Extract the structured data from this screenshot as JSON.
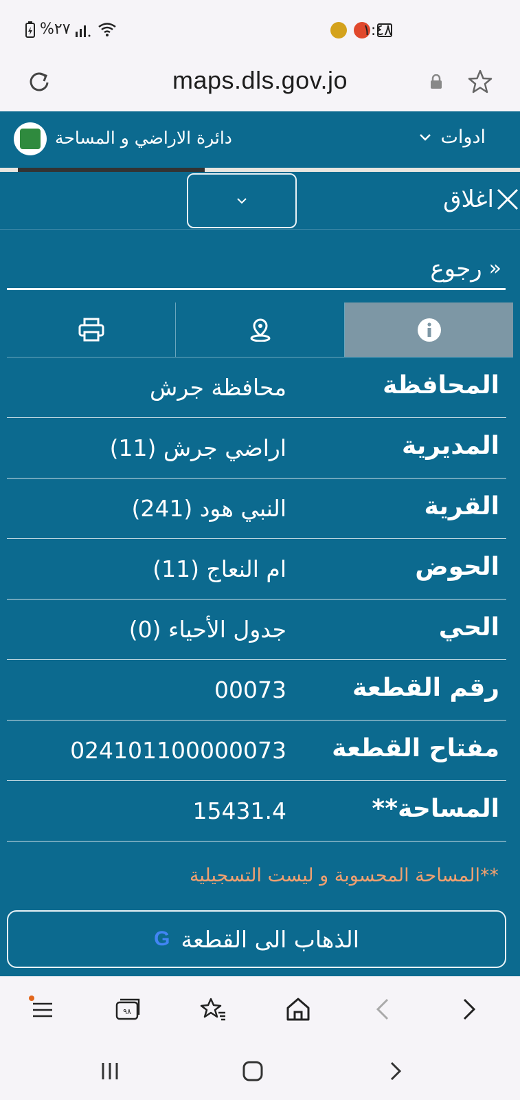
{
  "status_bar": {
    "time": "١:٤٨",
    "battery": "%٢٧",
    "signal_icon": "signal-icon",
    "wifi_icon": "wifi-icon"
  },
  "browser": {
    "url": "maps.dls.gov.jo"
  },
  "app_header": {
    "title": "دائرة الاراضي و المساحة",
    "tools_label": "ادوات"
  },
  "panel": {
    "close_label": "اغلاق",
    "back_label": "رجوع",
    "back_chevron": "«",
    "tabs": [
      {
        "name": "info",
        "icon": "info-icon",
        "active": true
      },
      {
        "name": "location",
        "icon": "location-pin-icon",
        "active": false
      },
      {
        "name": "print",
        "icon": "printer-icon",
        "active": false
      }
    ],
    "rows": [
      {
        "label": "المحافظة",
        "value": "محافظة جرش"
      },
      {
        "label": "المديرية",
        "value": "اراضي جرش (11)"
      },
      {
        "label": "القرية",
        "value": "النبي هود (241)"
      },
      {
        "label": "الحوض",
        "value": "ام النعاج (11)"
      },
      {
        "label": "الحي",
        "value": "جدول الأحياء (0)"
      },
      {
        "label": "رقم القطعة",
        "value": "00073"
      },
      {
        "label": "مفتاح القطعة",
        "value": "024101100000073"
      },
      {
        "label": "المساحة**",
        "value": "15431.4"
      }
    ],
    "note": "**المساحة المحسوبة و ليست التسجيلية",
    "goto_button": "الذهاب الى القطعة",
    "google_letter": "G"
  },
  "colors": {
    "panel": "#0c6a8f",
    "active_tab": "#7d97a5",
    "note": "#f0a070"
  }
}
